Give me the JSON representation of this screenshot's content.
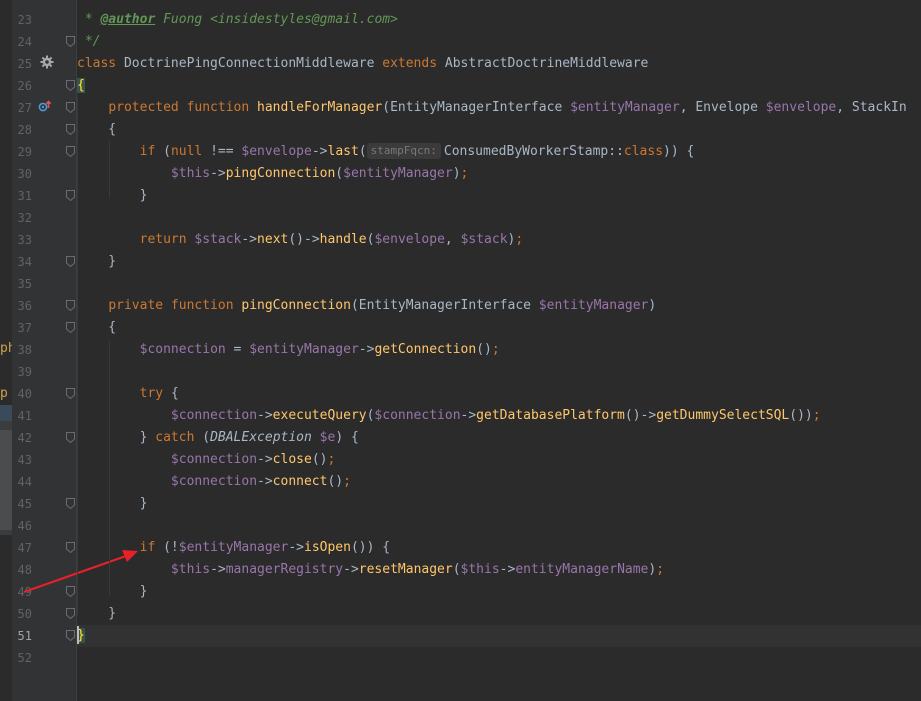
{
  "editor": {
    "lines": [
      {
        "num": "23",
        "parts": [
          [
            "cm",
            " * "
          ],
          [
            "doctag",
            "@author"
          ],
          [
            "cm",
            " Fuong <"
          ],
          [
            "cm",
            "insidestyles@gmail.com"
          ],
          [
            "cm",
            ">"
          ]
        ]
      },
      {
        "num": "24",
        "parts": [
          [
            "cm",
            " */"
          ]
        ]
      },
      {
        "num": "25",
        "parts": [
          [
            "kw",
            "class "
          ],
          [
            "plain",
            "DoctrinePingConnectionMiddleware "
          ],
          [
            "kw",
            "extends "
          ],
          [
            "plain",
            "AbstractDoctrineMiddleware"
          ]
        ]
      },
      {
        "num": "26",
        "parts": [
          [
            "brace",
            "{"
          ]
        ]
      },
      {
        "num": "27",
        "parts": [
          [
            "plain",
            "    "
          ],
          [
            "kw",
            "protected function "
          ],
          [
            "fn",
            "handleForManager"
          ],
          [
            "plain",
            "(EntityManagerInterface "
          ],
          [
            "var",
            "$entityManager"
          ],
          [
            "plain",
            ", Envelope "
          ],
          [
            "var",
            "$envelope"
          ],
          [
            "plain",
            ", StackIn"
          ]
        ]
      },
      {
        "num": "28",
        "parts": [
          [
            "plain",
            "    {"
          ]
        ]
      },
      {
        "num": "29",
        "parts": [
          [
            "plain",
            "        "
          ],
          [
            "kw",
            "if "
          ],
          [
            "plain",
            "("
          ],
          [
            "kw",
            "null "
          ],
          [
            "plain",
            "!== "
          ],
          [
            "var",
            "$envelope"
          ],
          [
            "plain",
            "->"
          ],
          [
            "fn",
            "last"
          ],
          [
            "plain",
            "("
          ],
          [
            "hint",
            "stampFqcn:"
          ],
          [
            "plain",
            "ConsumedByWorkerStamp::"
          ],
          [
            "kw",
            "class"
          ],
          [
            "plain",
            ")) {"
          ]
        ]
      },
      {
        "num": "30",
        "parts": [
          [
            "plain",
            "            "
          ],
          [
            "var",
            "$this"
          ],
          [
            "plain",
            "->"
          ],
          [
            "fn",
            "pingConnection"
          ],
          [
            "plain",
            "("
          ],
          [
            "var",
            "$entityManager"
          ],
          [
            "plain",
            ")"
          ],
          [
            "kw",
            ";"
          ]
        ]
      },
      {
        "num": "31",
        "parts": [
          [
            "plain",
            "        }"
          ]
        ]
      },
      {
        "num": "32",
        "parts": []
      },
      {
        "num": "33",
        "parts": [
          [
            "plain",
            "        "
          ],
          [
            "kw",
            "return "
          ],
          [
            "var",
            "$stack"
          ],
          [
            "plain",
            "->"
          ],
          [
            "fn",
            "next"
          ],
          [
            "plain",
            "()->"
          ],
          [
            "fn",
            "handle"
          ],
          [
            "plain",
            "("
          ],
          [
            "var",
            "$envelope"
          ],
          [
            "plain",
            ", "
          ],
          [
            "var",
            "$stack"
          ],
          [
            "plain",
            ")"
          ],
          [
            "kw",
            ";"
          ]
        ]
      },
      {
        "num": "34",
        "parts": [
          [
            "plain",
            "    }"
          ]
        ]
      },
      {
        "num": "35",
        "parts": []
      },
      {
        "num": "36",
        "parts": [
          [
            "plain",
            "    "
          ],
          [
            "kw",
            "private function "
          ],
          [
            "fn",
            "pingConnection"
          ],
          [
            "plain",
            "(EntityManagerInterface "
          ],
          [
            "var",
            "$entityManager"
          ],
          [
            "plain",
            ")"
          ]
        ]
      },
      {
        "num": "37",
        "parts": [
          [
            "plain",
            "    {"
          ]
        ]
      },
      {
        "num": "38",
        "parts": [
          [
            "plain",
            "        "
          ],
          [
            "var",
            "$connection"
          ],
          [
            "plain",
            " = "
          ],
          [
            "var",
            "$entityManager"
          ],
          [
            "plain",
            "->"
          ],
          [
            "fn",
            "getConnection"
          ],
          [
            "plain",
            "()"
          ],
          [
            "kw",
            ";"
          ]
        ]
      },
      {
        "num": "39",
        "parts": []
      },
      {
        "num": "40",
        "parts": [
          [
            "plain",
            "        "
          ],
          [
            "kw",
            "try "
          ],
          [
            "plain",
            "{"
          ]
        ]
      },
      {
        "num": "41",
        "parts": [
          [
            "plain",
            "            "
          ],
          [
            "var",
            "$connection"
          ],
          [
            "plain",
            "->"
          ],
          [
            "fn",
            "executeQuery"
          ],
          [
            "plain",
            "("
          ],
          [
            "var",
            "$connection"
          ],
          [
            "plain",
            "->"
          ],
          [
            "fn",
            "getDatabasePlatform"
          ],
          [
            "plain",
            "()->"
          ],
          [
            "fn",
            "getDummySelectSQL"
          ],
          [
            "plain",
            "())"
          ],
          [
            "kw",
            ";"
          ]
        ]
      },
      {
        "num": "42",
        "parts": [
          [
            "plain",
            "        } "
          ],
          [
            "kw",
            "catch "
          ],
          [
            "plain",
            "("
          ],
          [
            "exc",
            "DBALException"
          ],
          [
            "plain",
            " "
          ],
          [
            "var",
            "$e"
          ],
          [
            "plain",
            ") {"
          ]
        ]
      },
      {
        "num": "43",
        "parts": [
          [
            "plain",
            "            "
          ],
          [
            "var",
            "$connection"
          ],
          [
            "plain",
            "->"
          ],
          [
            "fn",
            "close"
          ],
          [
            "plain",
            "()"
          ],
          [
            "kw",
            ";"
          ]
        ]
      },
      {
        "num": "44",
        "parts": [
          [
            "plain",
            "            "
          ],
          [
            "var",
            "$connection"
          ],
          [
            "plain",
            "->"
          ],
          [
            "fn",
            "connect"
          ],
          [
            "plain",
            "()"
          ],
          [
            "kw",
            ";"
          ]
        ]
      },
      {
        "num": "45",
        "parts": [
          [
            "plain",
            "        }"
          ]
        ]
      },
      {
        "num": "46",
        "parts": []
      },
      {
        "num": "47",
        "parts": [
          [
            "plain",
            "        "
          ],
          [
            "kw",
            "if "
          ],
          [
            "plain",
            "(!"
          ],
          [
            "var",
            "$entityManager"
          ],
          [
            "plain",
            "->"
          ],
          [
            "fn",
            "isOpen"
          ],
          [
            "plain",
            "()) {"
          ]
        ]
      },
      {
        "num": "48",
        "parts": [
          [
            "plain",
            "            "
          ],
          [
            "var",
            "$this"
          ],
          [
            "plain",
            "->"
          ],
          [
            "var",
            "managerRegistry"
          ],
          [
            "plain",
            "->"
          ],
          [
            "fn",
            "resetManager"
          ],
          [
            "plain",
            "("
          ],
          [
            "var",
            "$this"
          ],
          [
            "plain",
            "->"
          ],
          [
            "var",
            "entityManagerName"
          ],
          [
            "plain",
            ")"
          ],
          [
            "kw",
            ";"
          ]
        ]
      },
      {
        "num": "49",
        "parts": [
          [
            "plain",
            "        }"
          ]
        ]
      },
      {
        "num": "50",
        "parts": [
          [
            "plain",
            "    }"
          ]
        ]
      },
      {
        "num": "51",
        "parts": [
          [
            "brace",
            "}"
          ]
        ]
      },
      {
        "num": "52",
        "parts": []
      }
    ],
    "current_line": "51",
    "fold_lines": [
      "24",
      "26",
      "27",
      "28",
      "29",
      "31",
      "34",
      "36",
      "37",
      "40",
      "42",
      "45",
      "47",
      "49",
      "50",
      "51"
    ],
    "left_panel_text_1": "ph",
    "left_panel_text_2": "p",
    "colors": {
      "background": "#2b2b2b",
      "gutter": "#313335",
      "keyword": "#cc7832",
      "variable": "#9876aa",
      "function": "#ffc66d",
      "comment": "#629755",
      "text": "#a9b7c6",
      "arrow": "#e8202a"
    },
    "icons": {
      "gear": "gear-icon",
      "override": "override-method-icon",
      "annotation_arrow": "red-arrow-annotation"
    }
  }
}
